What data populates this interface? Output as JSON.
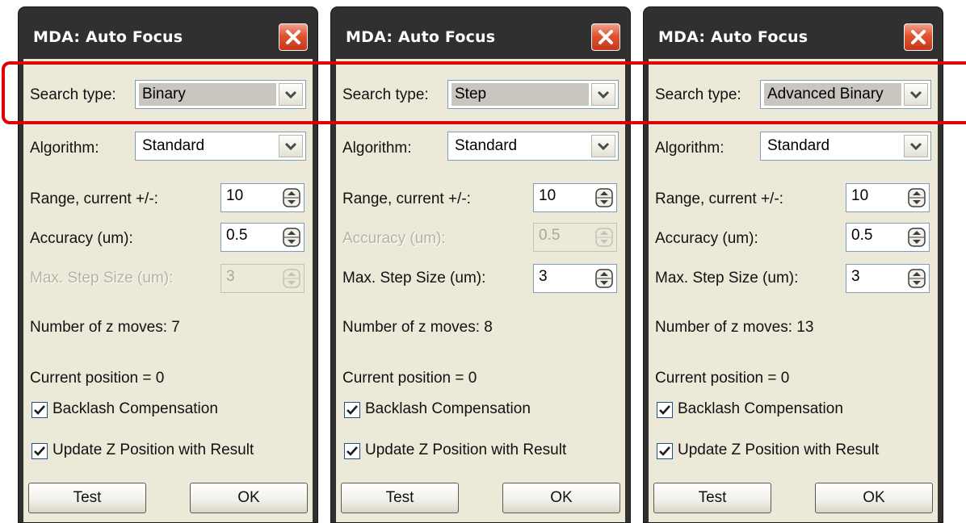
{
  "dialogs": [
    {
      "title": "MDA: Auto Focus",
      "search_type_label": "Search type:",
      "search_type_value": "Binary",
      "algorithm_label": "Algorithm:",
      "algorithm_value": "Standard",
      "range_label": "Range, current +/-:",
      "range_value": "10",
      "accuracy_label": "Accuracy (um):",
      "accuracy_value": "0.5",
      "accuracy_enabled": true,
      "maxstep_label": "Max. Step Size (um):",
      "maxstep_value": "3",
      "maxstep_enabled": false,
      "zmoves": "Number of z moves: 7",
      "current_position": "Current position = 0",
      "backlash_label": "Backlash Compensation",
      "backlash_checked": true,
      "update_z_label": "Update Z Position with Result",
      "update_z_checked": true,
      "test_button": "Test",
      "ok_button": "OK"
    },
    {
      "title": "MDA: Auto Focus",
      "search_type_label": "Search type:",
      "search_type_value": "Step",
      "algorithm_label": "Algorithm:",
      "algorithm_value": "Standard",
      "range_label": "Range, current +/-:",
      "range_value": "10",
      "accuracy_label": "Accuracy (um):",
      "accuracy_value": "0.5",
      "accuracy_enabled": false,
      "maxstep_label": "Max. Step Size (um):",
      "maxstep_value": "3",
      "maxstep_enabled": true,
      "zmoves": "Number of z moves: 8",
      "current_position": "Current position = 0",
      "backlash_label": "Backlash Compensation",
      "backlash_checked": true,
      "update_z_label": "Update Z Position with Result",
      "update_z_checked": true,
      "test_button": "Test",
      "ok_button": "OK"
    },
    {
      "title": "MDA: Auto Focus",
      "search_type_label": "Search type:",
      "search_type_value": "Advanced Binary",
      "algorithm_label": "Algorithm:",
      "algorithm_value": "Standard",
      "range_label": "Range, current +/-:",
      "range_value": "10",
      "accuracy_label": "Accuracy (um):",
      "accuracy_value": "0.5",
      "accuracy_enabled": true,
      "maxstep_label": "Max. Step Size (um):",
      "maxstep_value": "3",
      "maxstep_enabled": true,
      "zmoves": "Number of z moves: 13",
      "current_position": "Current position = 0",
      "backlash_label": "Backlash Compensation",
      "backlash_checked": true,
      "update_z_label": "Update Z Position with Result",
      "update_z_checked": true,
      "test_button": "Test",
      "ok_button": "OK"
    }
  ],
  "colors": {
    "titlebar": "#303030",
    "panel": "#ece9d8",
    "close_button": "#e0532f",
    "highlight_border": "#e00000",
    "disabled_text": "#b5b2a5"
  },
  "icons": {
    "close": "close-x-icon",
    "combo_arrow": "chevron-down-icon",
    "spinner": "spin-up-down-icon",
    "checkbox": "checkmark-icon"
  }
}
